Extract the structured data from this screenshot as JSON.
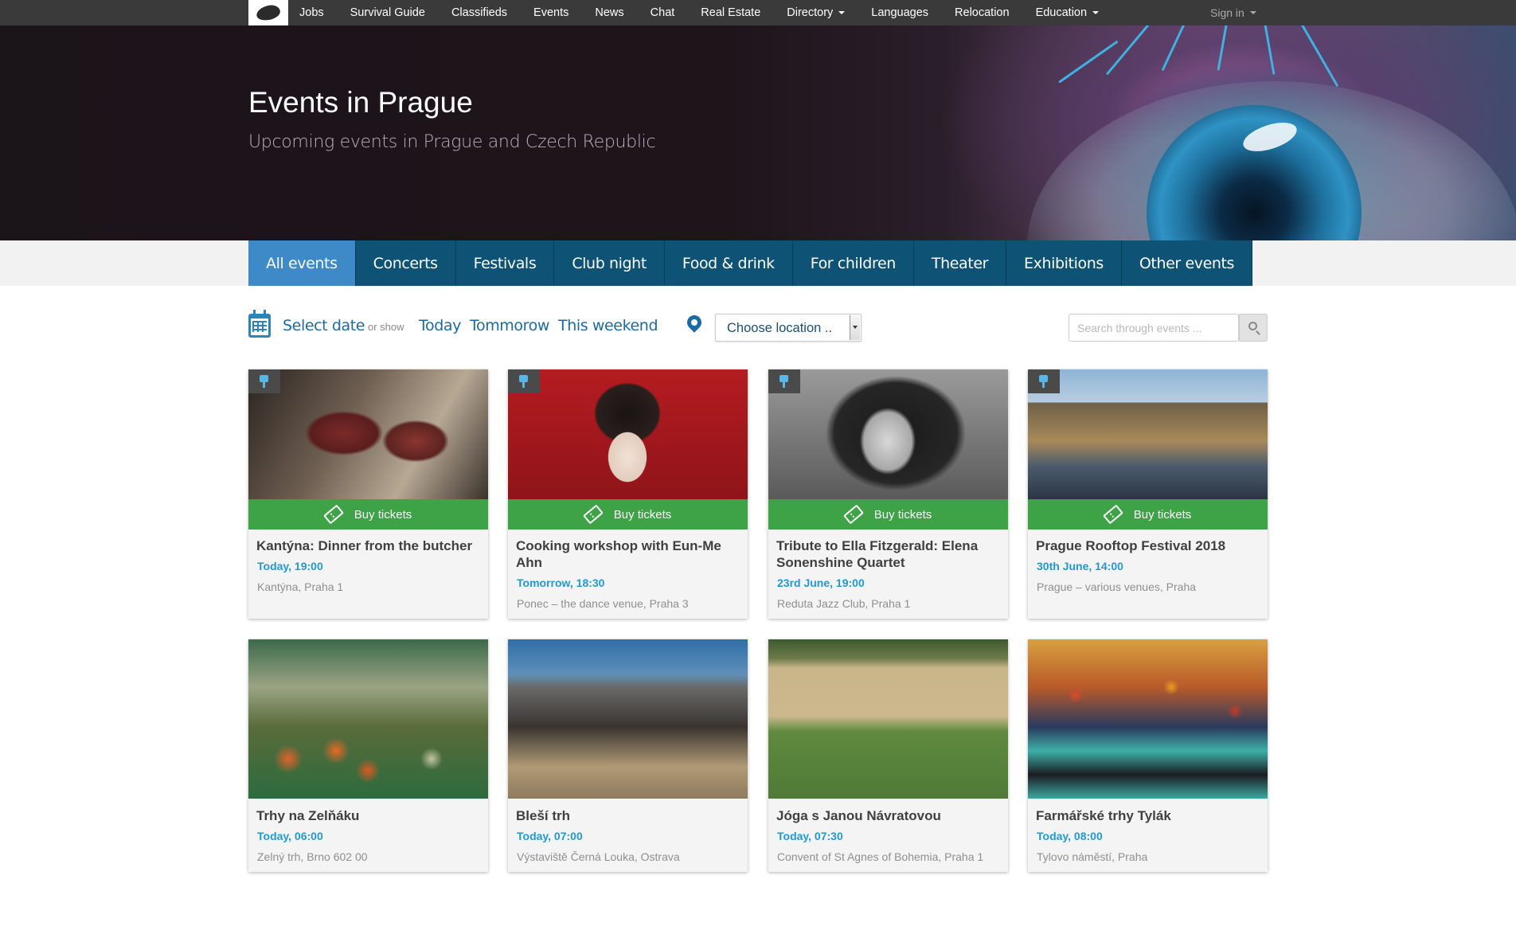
{
  "nav": {
    "links": [
      "Jobs",
      "Survival Guide",
      "Classifieds",
      "Events",
      "News",
      "Chat",
      "Real Estate",
      "Directory",
      "Languages",
      "Relocation",
      "Education"
    ],
    "sign_in": "Sign in"
  },
  "hero": {
    "title": "Events in Prague",
    "subtitle": "Upcoming events in Prague and Czech Republic"
  },
  "tabs": [
    "All events",
    "Concerts",
    "Festivals",
    "Club night",
    "Food & drink",
    "For children",
    "Theater",
    "Exhibitions",
    "Other events"
  ],
  "filters": {
    "select_date": "Select date",
    "or_show": "or show",
    "today": "Today",
    "tomorrow": "Tommorow",
    "weekend": "This weekend",
    "location": "Choose location ..",
    "search_placeholder": "Search through events ..."
  },
  "buy_label": "Buy tickets",
  "events": [
    {
      "title": "Kantýna: Dinner from the butcher",
      "date": "Today, 19:00",
      "venue": "Kantýna, Praha 1"
    },
    {
      "title": "Cooking workshop with Eun-Me Ahn",
      "date": "Tomorrow, 18:30",
      "venue": "Ponec – the dance venue, Praha 3"
    },
    {
      "title": "Tribute to Ella Fitzgerald: Elena Sonenshine Quartet",
      "date": "23rd June, 19:00",
      "venue": "Reduta Jazz Club, Praha 1"
    },
    {
      "title": "Prague Rooftop Festival 2018",
      "date": "30th June, 14:00",
      "venue": "Prague – various venues, Praha"
    },
    {
      "title": "Trhy na Zelňáku",
      "date": "Today, 06:00",
      "venue": "Zelný trh, Brno 602 00"
    },
    {
      "title": "Bleší trh",
      "date": "Today, 07:00",
      "venue": "Výstaviště Černá Louka, Ostrava"
    },
    {
      "title": "Jóga s Janou Návratovou",
      "date": "Today, 07:30",
      "venue": "Convent of St Agnes of Bohemia, Praha 1"
    },
    {
      "title": "Farmářské trhy Tylák",
      "date": "Today, 08:00",
      "venue": "Tylovo náměstí, Praha"
    }
  ],
  "colors": {
    "nav_bg": "#3a3a3a",
    "tab_bg": "#0e5275",
    "tab_active": "#3e8ac9",
    "link": "#1a6aa5",
    "buy_green": "#3ea247",
    "date_blue": "#2299d5"
  }
}
